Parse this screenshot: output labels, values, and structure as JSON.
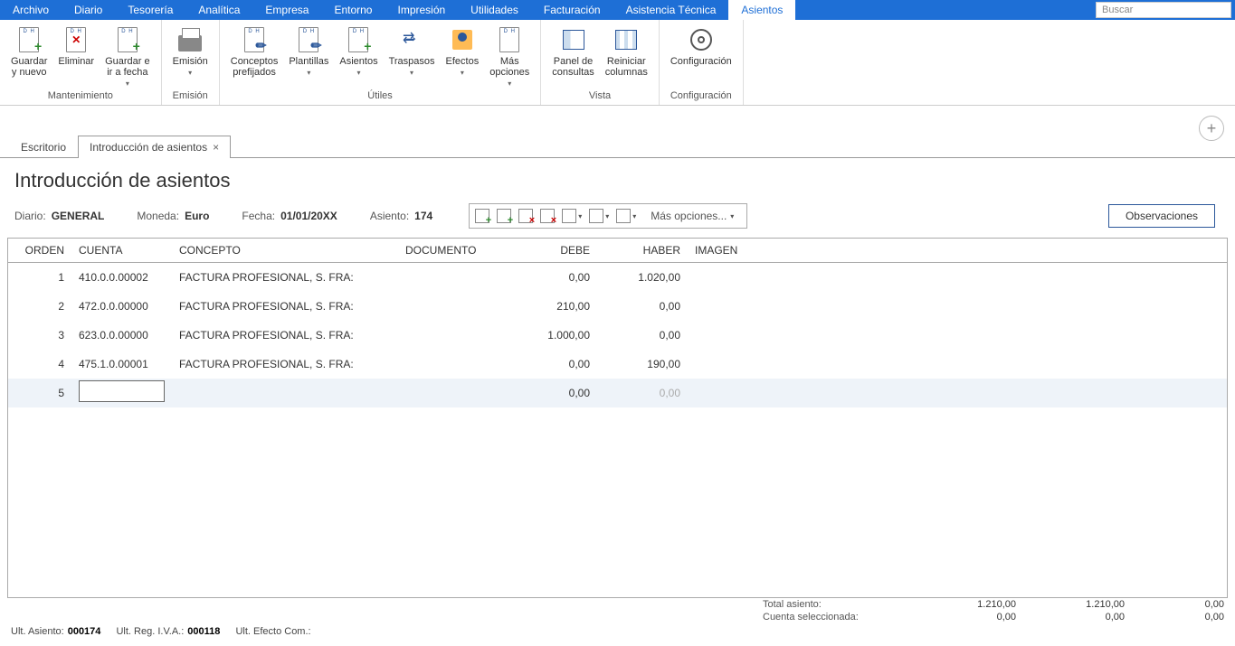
{
  "menu": {
    "items": [
      "Archivo",
      "Diario",
      "Tesorería",
      "Analítica",
      "Empresa",
      "Entorno",
      "Impresión",
      "Utilidades",
      "Facturación",
      "Asistencia Técnica",
      "Asientos"
    ],
    "activeIndex": 10,
    "searchPlaceholder": "Buscar"
  },
  "ribbon": {
    "groups": [
      {
        "label": "Mantenimiento",
        "buttons": [
          {
            "name": "guardar-nuevo",
            "label": "Guardar\ny nuevo",
            "icon": "doc-plus"
          },
          {
            "name": "eliminar",
            "label": "Eliminar",
            "icon": "doc-x"
          },
          {
            "name": "guardar-ir-fecha",
            "label": "Guardar e\nir a fecha",
            "icon": "doc-plus",
            "dropdown": true
          }
        ]
      },
      {
        "label": "Emisión",
        "buttons": [
          {
            "name": "emision",
            "label": "Emisión",
            "icon": "printer",
            "dropdown": true
          }
        ]
      },
      {
        "label": "Útiles",
        "buttons": [
          {
            "name": "conceptos-prefijados",
            "label": "Conceptos\nprefijados",
            "icon": "doc-pen"
          },
          {
            "name": "plantillas",
            "label": "Plantillas",
            "icon": "doc-pen",
            "dropdown": true
          },
          {
            "name": "asientos",
            "label": "Asientos",
            "icon": "doc-plus",
            "dropdown": true
          },
          {
            "name": "traspasos",
            "label": "Traspasos",
            "icon": "swap",
            "dropdown": true
          },
          {
            "name": "efectos",
            "label": "Efectos",
            "icon": "people",
            "dropdown": true
          },
          {
            "name": "mas-opciones",
            "label": "Más\nopciones",
            "icon": "doc-dh",
            "dropdown": true
          }
        ]
      },
      {
        "label": "Vista",
        "buttons": [
          {
            "name": "panel-consultas",
            "label": "Panel de\nconsultas",
            "icon": "panel-split"
          },
          {
            "name": "reiniciar-columnas",
            "label": "Reiniciar\ncolumnas",
            "icon": "panel-cols"
          }
        ]
      },
      {
        "label": "Configuración",
        "buttons": [
          {
            "name": "configuracion",
            "label": "Configuración",
            "icon": "gear"
          }
        ]
      }
    ]
  },
  "tabs": {
    "items": [
      {
        "label": "Escritorio",
        "closable": false
      },
      {
        "label": "Introducción de asientos",
        "closable": true
      }
    ],
    "activeIndex": 1
  },
  "page": {
    "title": "Introducción de asientos",
    "info": {
      "diarioLabel": "Diario:",
      "diario": "GENERAL",
      "monedaLabel": "Moneda:",
      "moneda": "Euro",
      "fechaLabel": "Fecha:",
      "fecha": "01/01/20XX",
      "asientoLabel": "Asiento:",
      "asiento": "174"
    },
    "toolbar": {
      "moreLabel": "Más opciones..."
    },
    "obsButton": "Observaciones"
  },
  "grid": {
    "headers": {
      "orden": "ORDEN",
      "cuenta": "CUENTA",
      "concepto": "CONCEPTO",
      "documento": "DOCUMENTO",
      "debe": "DEBE",
      "haber": "HABER",
      "imagen": "IMAGEN"
    },
    "rows": [
      {
        "orden": "1",
        "cuenta": "410.0.0.00002",
        "concepto": "FACTURA PROFESIONAL, S. FRA:",
        "documento": "",
        "debe": "0,00",
        "haber": "1.020,00"
      },
      {
        "orden": "2",
        "cuenta": "472.0.0.00000",
        "concepto": "FACTURA PROFESIONAL, S. FRA:",
        "documento": "",
        "debe": "210,00",
        "haber": "0,00"
      },
      {
        "orden": "3",
        "cuenta": "623.0.0.00000",
        "concepto": "FACTURA PROFESIONAL, S. FRA:",
        "documento": "",
        "debe": "1.000,00",
        "haber": "0,00"
      },
      {
        "orden": "4",
        "cuenta": "475.1.0.00001",
        "concepto": "FACTURA PROFESIONAL, S. FRA:",
        "documento": "",
        "debe": "0,00",
        "haber": "190,00"
      }
    ],
    "editRow": {
      "orden": "5",
      "debe": "0,00",
      "haber": "0,00"
    }
  },
  "footer": {
    "totals": {
      "labels": {
        "total": "Total asiento:",
        "cuenta": "Cuenta seleccionada:"
      },
      "total": {
        "debe": "1.210,00",
        "haber": "1.210,00",
        "dif": "0,00"
      },
      "cuenta": {
        "debe": "0,00",
        "haber": "0,00",
        "dif": "0,00"
      }
    },
    "status": {
      "ultAsientoLabel": "Ult. Asiento:",
      "ultAsiento": "000174",
      "ultRegIvaLabel": "Ult. Reg. I.V.A.:",
      "ultRegIva": "000118",
      "ultEfectoLabel": "Ult. Efecto Com.:",
      "ultEfecto": ""
    }
  }
}
